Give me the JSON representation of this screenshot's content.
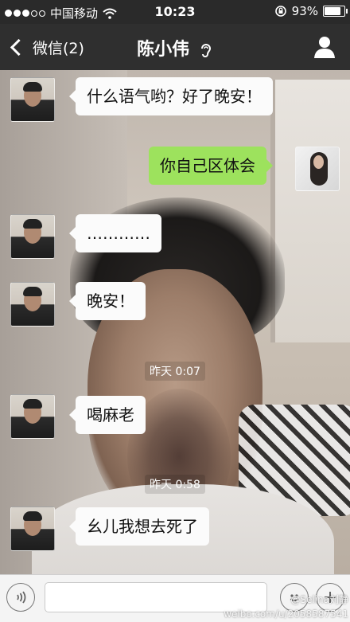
{
  "status_bar": {
    "carrier": "中国移动",
    "time": "10:23",
    "battery": "93%",
    "battery_level": 0.93,
    "signal_bars_filled": 3,
    "signal_bars_total": 5
  },
  "nav": {
    "back_label": "微信(2)",
    "title": "陈小伟"
  },
  "messages": [
    {
      "side": "left",
      "text": "什么语气哟？好了晚安！"
    },
    {
      "side": "right",
      "text": "你自己区体会"
    },
    {
      "side": "left",
      "text": "…………"
    },
    {
      "side": "left",
      "text": "晚安！"
    },
    {
      "side": "time",
      "text": "昨天 0:07"
    },
    {
      "side": "left",
      "text": "喝麻老"
    },
    {
      "side": "time",
      "text": "昨天 0:58"
    },
    {
      "side": "left",
      "text": "幺儿我想去死了"
    }
  ],
  "input": {
    "value": ""
  },
  "watermark": {
    "line1": "@Selina刘静",
    "line2": "weibo.com/u/2058587541"
  },
  "colors": {
    "bubble_sent": "#9de25d",
    "bubble_received": "#fbfbfb",
    "nav_background": "#2f2f2f"
  },
  "icons": {
    "back": "chevron-left-icon",
    "ear": "ear-icon",
    "profile": "person-icon",
    "voice": "voice-icon",
    "emoji": "smiley-icon",
    "plus": "plus-icon"
  }
}
